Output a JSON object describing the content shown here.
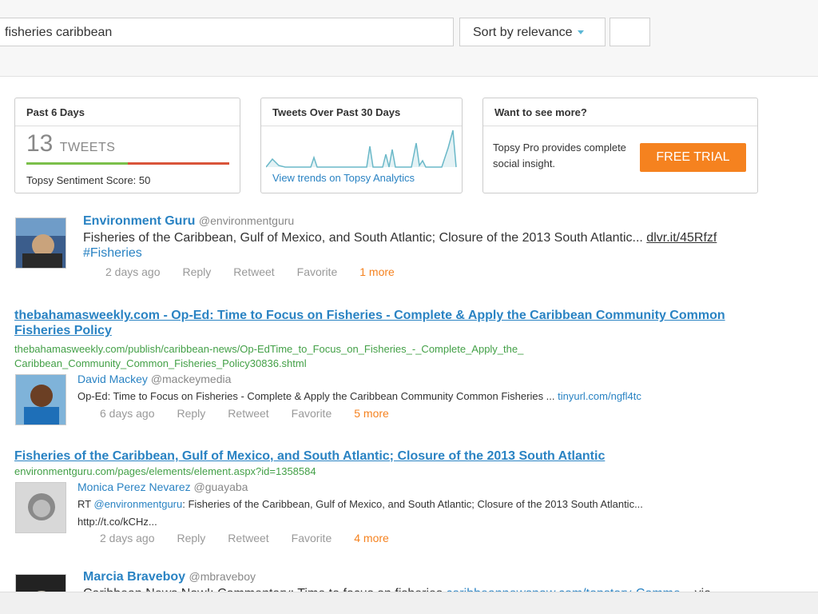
{
  "search": {
    "query": "fisheries caribbean"
  },
  "sort": {
    "label": "Sort by relevance"
  },
  "summary": {
    "past_days": {
      "title": "Past 6 Days",
      "count": "13",
      "count_label": "TWEETS",
      "sentiment_text": "Topsy Sentiment Score: 50",
      "sentiment_score": 50
    },
    "trend": {
      "title": "Tweets Over Past 30 Days",
      "link": "View trends on Topsy Analytics"
    },
    "more": {
      "title": "Want to see more?",
      "text": "Topsy Pro provides complete social insight.",
      "button": "FREE TRIAL"
    }
  },
  "results": [
    {
      "author": "Environment Guru",
      "handle": "@environmentguru",
      "text": "Fisheries of the Caribbean, Gulf of Mexico, and South Atlantic; Closure of the 2013 South Atlantic...",
      "link": "dlvr.it/45Rfzf",
      "hashtag": "#Fisheries",
      "time": "2 days ago",
      "reply": "Reply",
      "retweet": "Retweet",
      "favorite": "Favorite",
      "more": "1 more"
    },
    {
      "title": "thebahamasweekly.com - Op-Ed: Time to Focus on Fisheries - Complete & Apply the Caribbean Community Common Fisheries Policy",
      "url": "thebahamasweekly.com/publish/caribbean-news/Op-EdTime_to_Focus_on_Fisheries_-_Complete_Apply_the_Caribbean_Community_Common_Fisheries_Policy30836.shtml",
      "author": "David Mackey",
      "handle": "@mackeymedia",
      "text": "Op-Ed: Time to Focus on Fisheries - Complete & Apply the Caribbean Community Common Fisheries ...",
      "link": "tinyurl.com/ngfl4tc",
      "time": "6 days ago",
      "reply": "Reply",
      "retweet": "Retweet",
      "favorite": "Favorite",
      "more": "5 more"
    },
    {
      "title": "Fisheries of the Caribbean, Gulf of Mexico, and South Atlantic; Closure of the 2013 South Atlantic",
      "url": "environmentguru.com/pages/elements/element.aspx?id=1358584",
      "author": "Monica Perez Nevarez",
      "handle": "@guayaba",
      "text_prefix": "RT ",
      "mention": "@environmentguru",
      "text": ": Fisheries of the Caribbean, Gulf of Mexico, and South Atlantic; Closure of the 2013 South Atlantic...",
      "text2": "http://t.co/kCHz...",
      "time": "2 days ago",
      "reply": "Reply",
      "retweet": "Retweet",
      "favorite": "Favorite",
      "more": "4 more"
    },
    {
      "author": "Marcia Braveboy",
      "handle": "@mbraveboy",
      "text": "Caribbean News Now!: Commentary: Time to focus on fisheries",
      "link": "caribbeannewsnow.com/topstory-Comme...",
      "suffix": "via"
    }
  ],
  "colors": {
    "link": "#2a83c3",
    "accent": "#f5821f",
    "url": "#43a047"
  }
}
